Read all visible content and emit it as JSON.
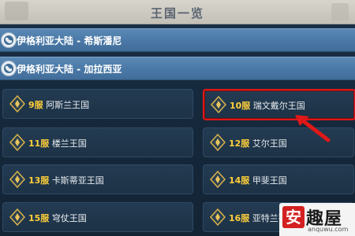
{
  "window": {
    "title": "王国一览"
  },
  "regions": [
    {
      "label": "伊格利亚大陆 - 希斯潘尼"
    },
    {
      "label": "伊格利亚大陆 - 加拉西亚"
    }
  ],
  "kingdoms": [
    {
      "server": "9服",
      "name": "阿斯兰王国"
    },
    {
      "server": "10服",
      "name": "瑞文戴尔王国"
    },
    {
      "server": "11服",
      "name": "楼兰王国"
    },
    {
      "server": "12服",
      "name": "艾尔王国"
    },
    {
      "server": "13服",
      "name": "卡斯蒂亚王国"
    },
    {
      "server": "14服",
      "name": "甲斐王国"
    },
    {
      "server": "15服",
      "name": "穹仗王国"
    },
    {
      "server": "16服",
      "name": "亚特兰蒂"
    }
  ],
  "watermark": {
    "mark": "安",
    "brand": "趣屋",
    "url": "anquwu.com"
  },
  "colors": {
    "highlight": "#e01818",
    "server_number": "#ffcf3a",
    "region_bar": "#4a78a6"
  }
}
